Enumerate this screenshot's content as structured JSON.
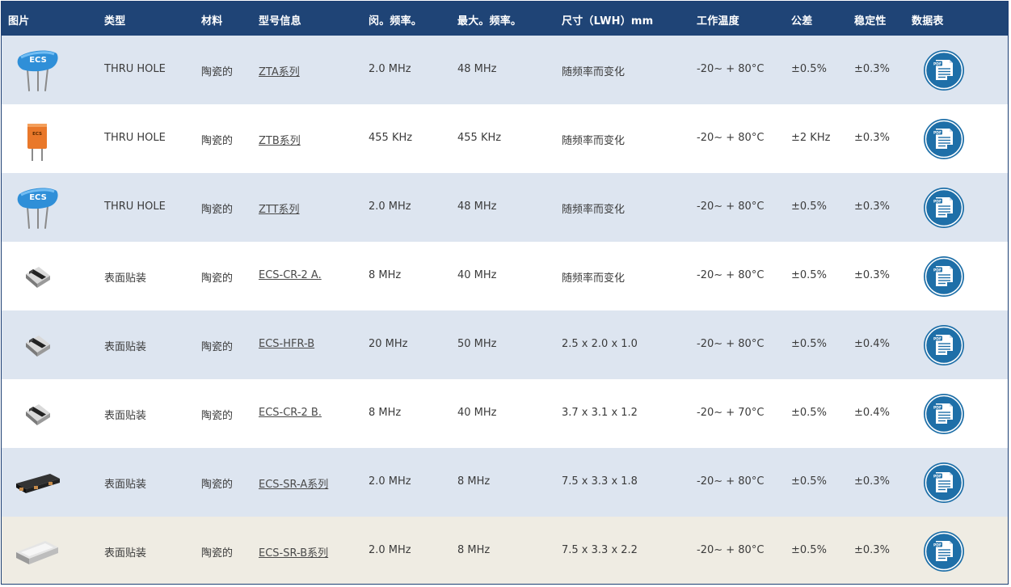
{
  "header": {
    "image": "图片",
    "type": "类型",
    "material": "材料",
    "model": "型号信息",
    "min_freq": "闵。频率。",
    "max_freq": "最大。频率。",
    "size": "尺寸（LWH）mm",
    "temp": "工作温度",
    "tolerance": "公差",
    "stability": "稳定性",
    "datasheet": "数据表"
  },
  "rows": [
    {
      "type": "THRU HOLE",
      "material": "陶瓷的",
      "model": "ZTA系列",
      "min": "2.0 MHz",
      "max": "48 MHz",
      "size": "随频率而变化",
      "temp": "-20~ + 80°C",
      "tol": "±0.5%",
      "stab": "±0.3%"
    },
    {
      "type": "THRU HOLE",
      "material": "陶瓷的",
      "model": "ZTB系列",
      "min": "455 KHz",
      "max": "455 KHz",
      "size": "随频率而变化",
      "temp": "-20~ + 80°C",
      "tol": "±2 KHz",
      "stab": "±0.3%"
    },
    {
      "type": "THRU HOLE",
      "material": "陶瓷的",
      "model": "ZTT系列",
      "min": "2.0 MHz",
      "max": "48 MHz",
      "size": "随频率而变化",
      "temp": "-20~ + 80°C",
      "tol": "±0.5%",
      "stab": "±0.3%"
    },
    {
      "type": "表面贴装",
      "material": "陶瓷的",
      "model": "ECS-CR-2 A.",
      "min": "8 MHz",
      "max": "40 MHz",
      "size": "随频率而变化",
      "temp": "-20~ + 80°C",
      "tol": "±0.5%",
      "stab": "±0.3%"
    },
    {
      "type": "表面贴装",
      "material": "陶瓷的",
      "model": "ECS-HFR-B",
      "min": "20 MHz",
      "max": "50 MHz",
      "size": "2.5 x 2.0 x 1.0",
      "temp": "-20~ + 80°C",
      "tol": "±0.5%",
      "stab": "±0.4%"
    },
    {
      "type": "表面贴装",
      "material": "陶瓷的",
      "model": "ECS-CR-2 B.",
      "min": "8 MHz",
      "max": "40 MHz",
      "size": "3.7 x 3.1 x 1.2",
      "temp": "-20~ + 70°C",
      "tol": "±0.5%",
      "stab": "±0.4%"
    },
    {
      "type": "表面贴装",
      "material": "陶瓷的",
      "model": "ECS-SR-A系列",
      "min": "2.0 MHz",
      "max": "8 MHz",
      "size": "7.5 x 3.3 x 1.8",
      "temp": "-20~ + 80°C",
      "tol": "±0.5%",
      "stab": "±0.3%"
    },
    {
      "type": "表面贴装",
      "material": "陶瓷的",
      "model": "ECS-SR-B系列",
      "min": "2.0 MHz",
      "max": "8 MHz",
      "size": "7.5 x 3.3 x 2.2",
      "temp": "-20~ + 80°C",
      "tol": "±0.5%",
      "stab": "±0.3%"
    }
  ],
  "logos": {
    "ecs_blue": "ECS",
    "ecs_orange": "ECS"
  },
  "pdf_icon_label": "PDF",
  "colors": {
    "header_bg": "#1f4476",
    "row_blue": "#dde5f0",
    "row_beige": "#efece3",
    "pdf_blue": "#1e6fa8"
  }
}
